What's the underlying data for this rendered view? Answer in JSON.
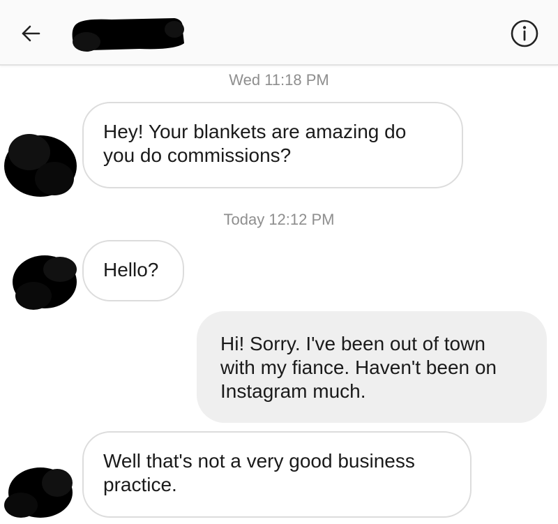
{
  "header": {
    "back_icon": "arrow-left-icon",
    "contact_name": "",
    "info_icon": "info-circle-icon"
  },
  "messages": [
    {
      "type": "timestamp",
      "text": "Wed 11:18 PM"
    },
    {
      "type": "incoming",
      "text": "Hey! Your blankets are amazing do you do commissions?"
    },
    {
      "type": "timestamp",
      "text": "Today 12:12 PM"
    },
    {
      "type": "incoming",
      "text": "Hello?"
    },
    {
      "type": "outgoing",
      "text": "Hi! Sorry. I've been out of town with my fiance. Haven't been on Instagram much."
    },
    {
      "type": "incoming",
      "text": "Well that's not a very good business practice."
    }
  ],
  "colors": {
    "header_bg": "#fafafa",
    "incoming_bubble_bg": "#ffffff",
    "incoming_bubble_border": "#dcdcdc",
    "outgoing_bubble_bg": "#efefef",
    "timestamp_text": "#8e8e8e",
    "redaction": "#000000"
  }
}
